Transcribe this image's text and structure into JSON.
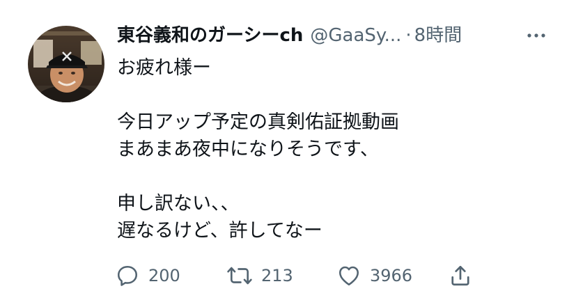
{
  "tweet": {
    "display_name": "東谷義和のガーシーch",
    "handle": "@GaaSy...",
    "separator": "·",
    "time": "8時間",
    "body_lines": [
      "お疲れ様ー",
      "",
      "今日アップ予定の真剣佑証拠動画",
      "まあまあ夜中になりそうです、",
      "",
      "申し訳ない、、",
      "遅なるけど、許してなー"
    ]
  },
  "actions": {
    "reply_count": "200",
    "retweet_count": "213",
    "like_count": "3966"
  },
  "icons": {
    "more": "more-horizontal-icon",
    "reply": "reply-bubble-icon",
    "retweet": "retweet-arrows-icon",
    "like": "heart-icon",
    "share": "share-upload-icon"
  },
  "colors": {
    "text_primary": "#0f1419",
    "text_secondary": "#536471",
    "background": "#ffffff"
  }
}
